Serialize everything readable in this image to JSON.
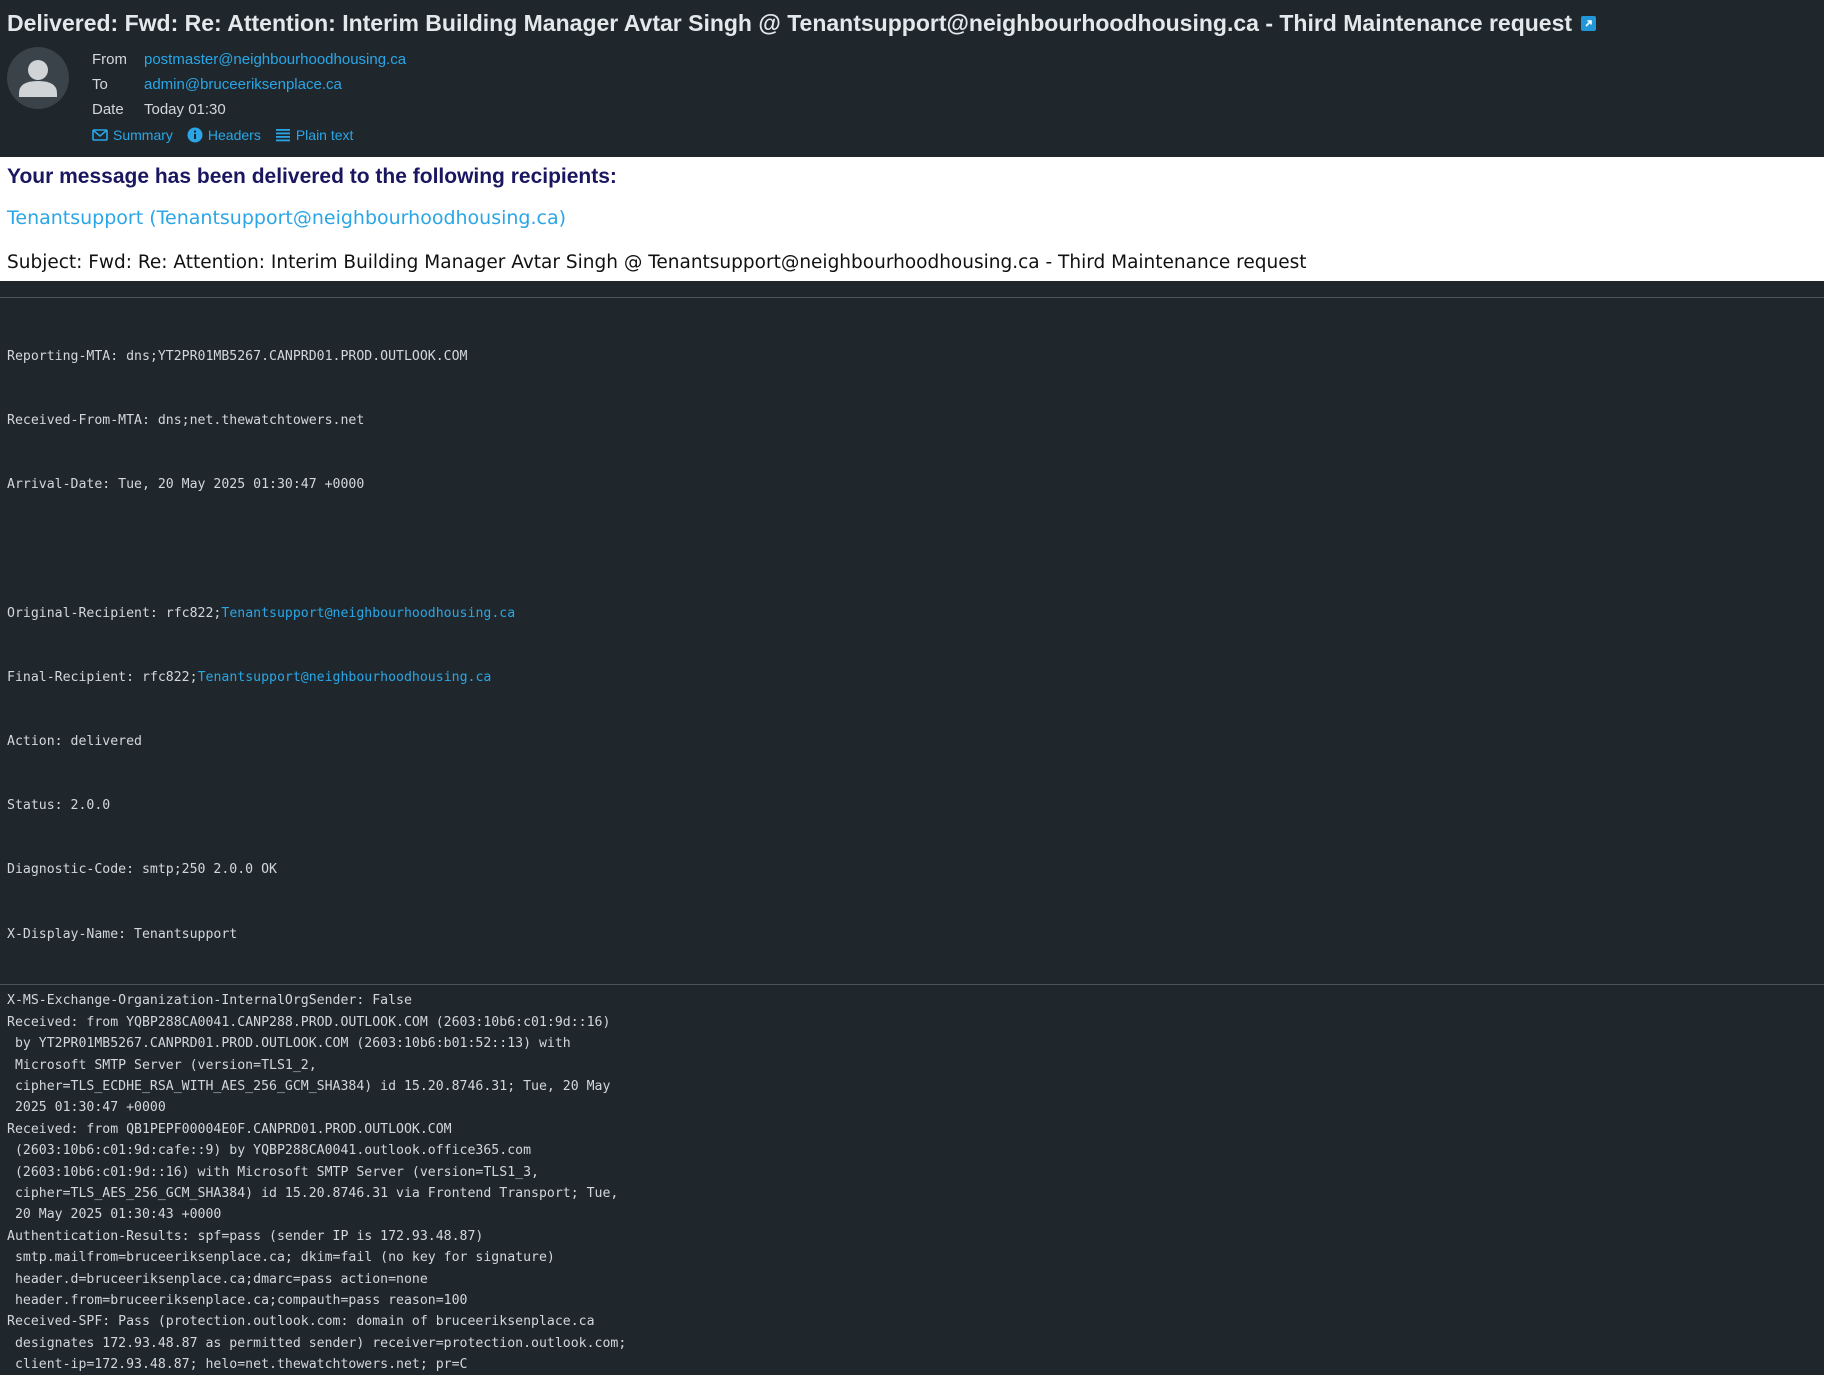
{
  "email": {
    "subject": "Delivered: Fwd: Re: Attention: Interim Building Manager Avtar Singh @ Tenantsupport@neighbourhoodhousing.ca - Third Maintenance request",
    "from_label": "From",
    "from_value": "postmaster@neighbourhoodhousing.ca",
    "to_label": "To",
    "to_value": "admin@bruceeriksenplace.ca",
    "date_label": "Date",
    "date_value": "Today 01:30",
    "actions": {
      "summary": "Summary",
      "headers": "Headers",
      "plain_text": "Plain text"
    }
  },
  "body": {
    "delivered_title": "Your message has been delivered to the following recipients:",
    "recipient": "Tenantsupport (Tenantsupport@neighbourhoodhousing.ca)",
    "subject_line": "Subject: Fwd: Re: Attention: Interim Building Manager Avtar Singh @ Tenantsupport@neighbourhoodhousing.ca - Third Maintenance request"
  },
  "report": {
    "reporting_mta": "Reporting-MTA: dns;YT2PR01MB5267.CANPRD01.PROD.OUTLOOK.COM",
    "received_from_mta": "Received-From-MTA: dns;net.thewatchtowers.net",
    "arrival_date": "Arrival-Date: Tue, 20 May 2025 01:30:47 +0000",
    "original_recipient_prefix": "Original-Recipient: rfc822;",
    "original_recipient_addr": "Tenantsupport@neighbourhoodhousing.ca",
    "final_recipient_prefix": "Final-Recipient: rfc822;",
    "final_recipient_addr": "Tenantsupport@neighbourhoodhousing.ca",
    "action": "Action: delivered",
    "status": "Status: 2.0.0",
    "diagnostic_code": "Diagnostic-Code: smtp;250 2.0.0 OK",
    "display_name": "X-Display-Name: Tenantsupport"
  },
  "headers_lines": [
    "X-MS-Exchange-Organization-InternalOrgSender: False",
    "Received: from YQBP288CA0041.CANP288.PROD.OUTLOOK.COM (2603:10b6:c01:9d::16)",
    " by YT2PR01MB5267.CANPRD01.PROD.OUTLOOK.COM (2603:10b6:b01:52::13) with",
    " Microsoft SMTP Server (version=TLS1_2,",
    " cipher=TLS_ECDHE_RSA_WITH_AES_256_GCM_SHA384) id 15.20.8746.31; Tue, 20 May",
    " 2025 01:30:47 +0000",
    "Received: from QB1PEPF00004E0F.CANPRD01.PROD.OUTLOOK.COM",
    " (2603:10b6:c01:9d:cafe::9) by YQBP288CA0041.outlook.office365.com",
    " (2603:10b6:c01:9d::16) with Microsoft SMTP Server (version=TLS1_3,",
    " cipher=TLS_AES_256_GCM_SHA384) id 15.20.8746.31 via Frontend Transport; Tue,",
    " 20 May 2025 01:30:43 +0000",
    "Authentication-Results: spf=pass (sender IP is 172.93.48.87)",
    " smtp.mailfrom=bruceeriksenplace.ca; dkim=fail (no key for signature)",
    " header.d=bruceeriksenplace.ca;dmarc=pass action=none",
    " header.from=bruceeriksenplace.ca;compauth=pass reason=100",
    "Received-SPF: Pass (protection.outlook.com: domain of bruceeriksenplace.ca",
    " designates 172.93.48.87 as permitted sender) receiver=protection.outlook.com;",
    " client-ip=172.93.48.87; helo=net.thewatchtowers.net; pr=C"
  ],
  "colors": {
    "background": "#1f272c",
    "link": "#2aa6e6",
    "title_navy": "#1a1660"
  }
}
